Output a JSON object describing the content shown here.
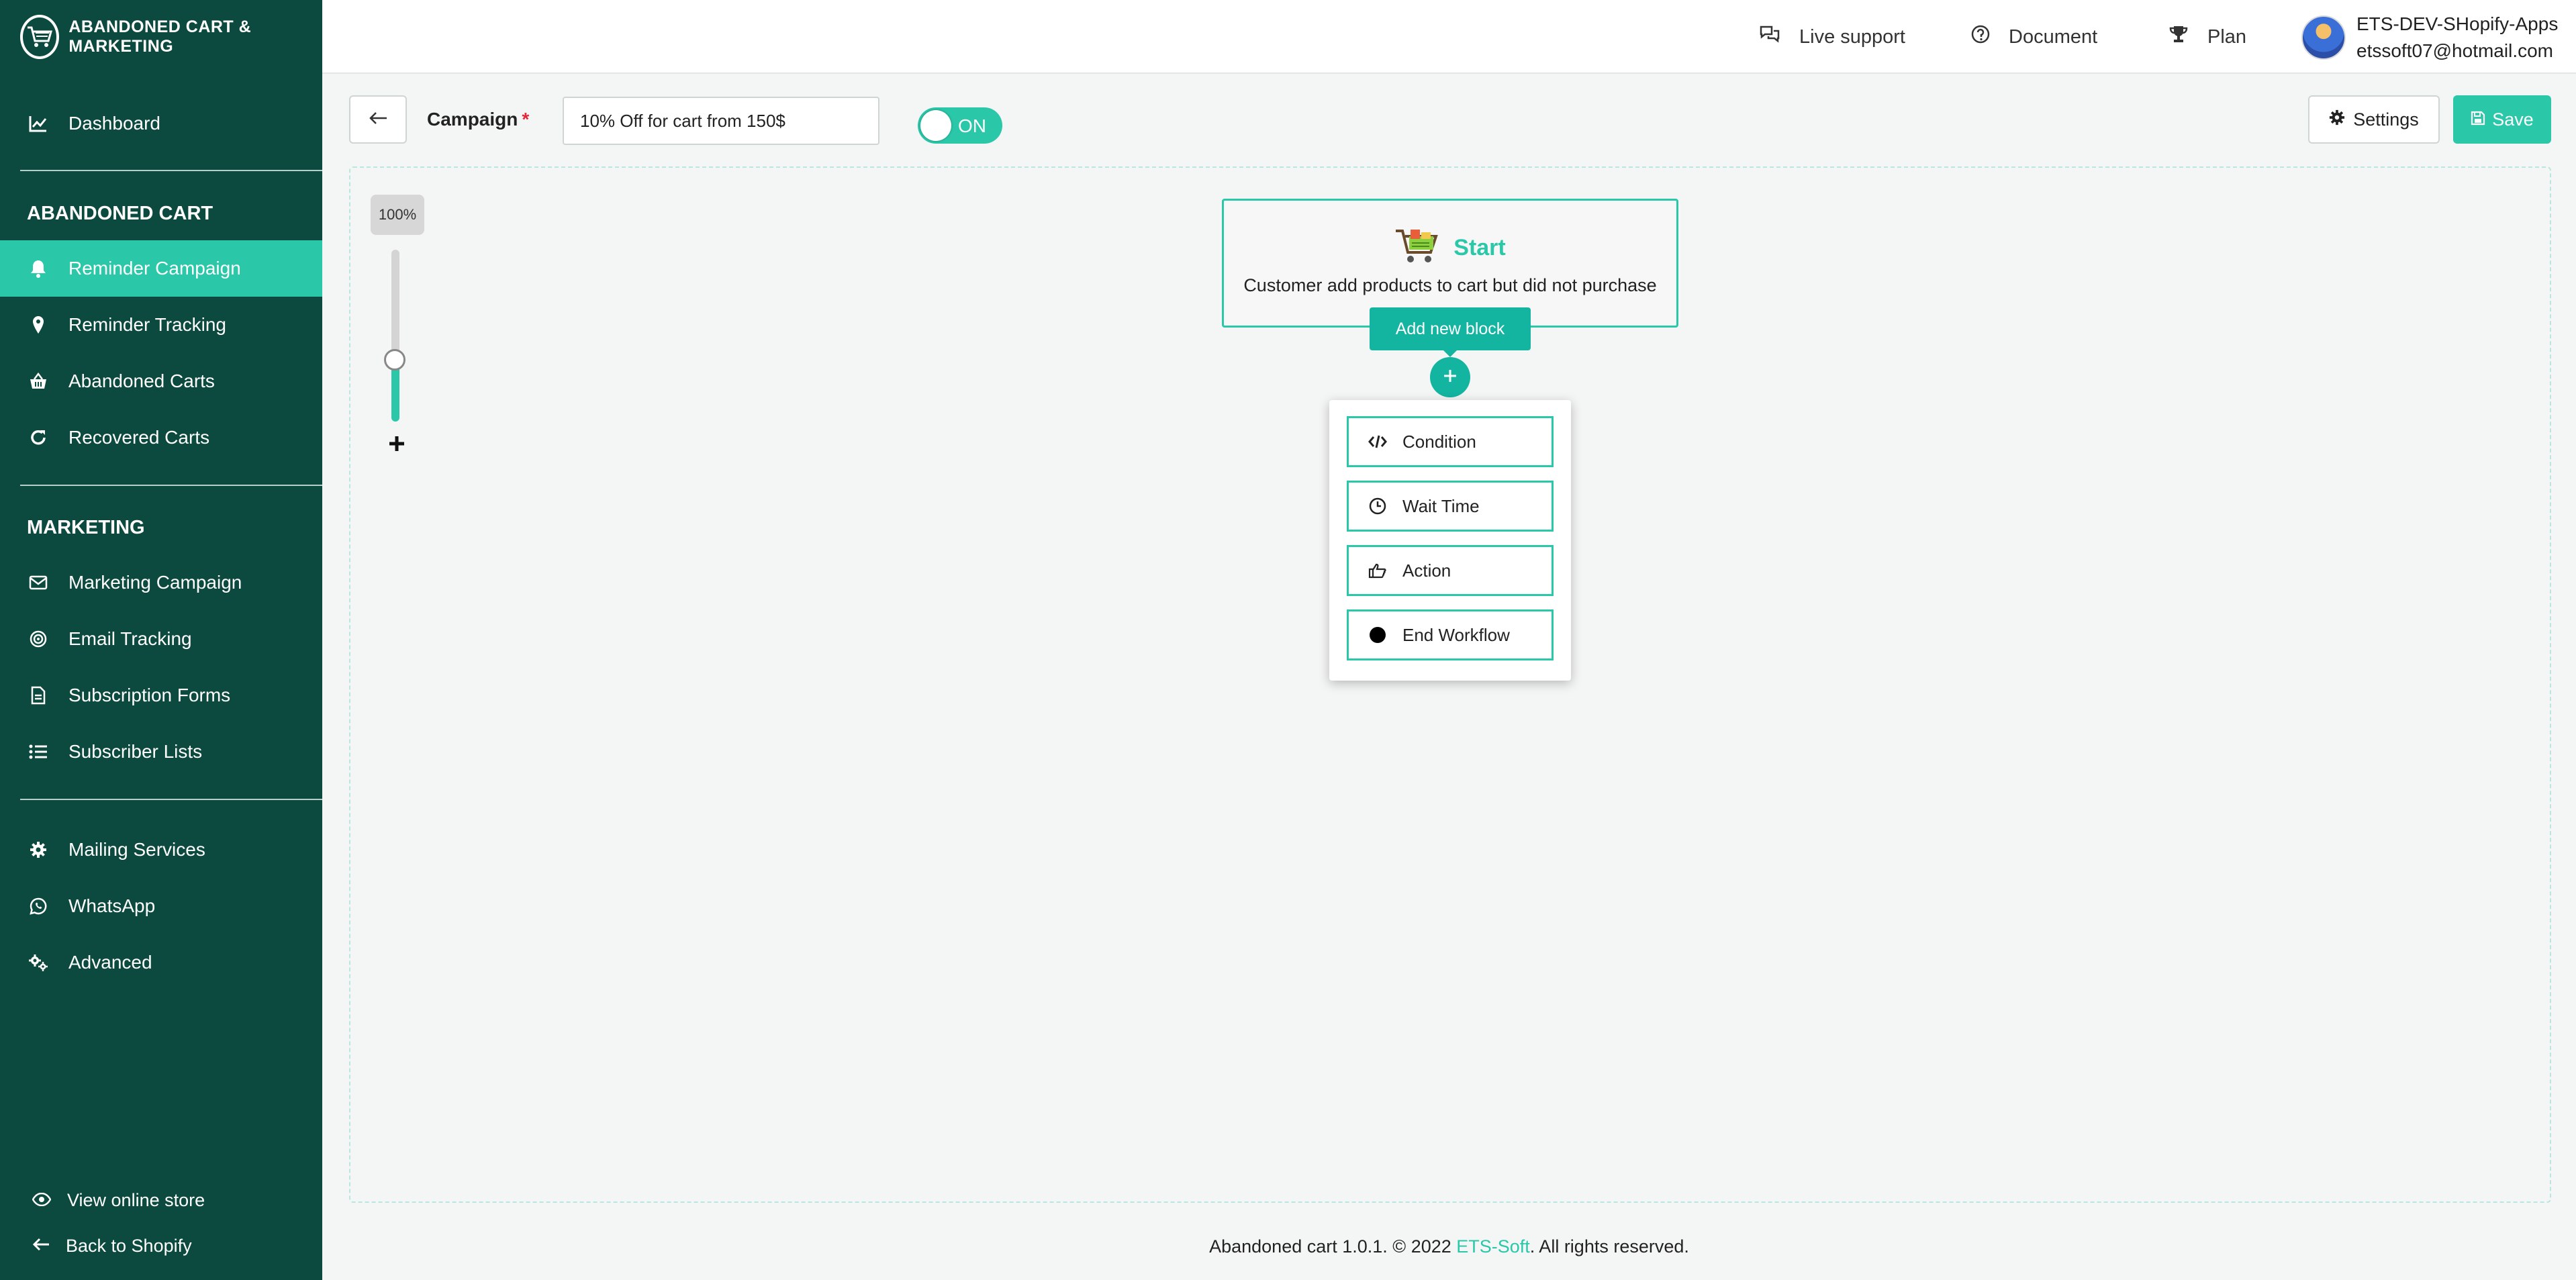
{
  "app": {
    "title": "ABANDONED CART & MARKETING"
  },
  "sidebar": {
    "dashboard": "Dashboard",
    "abandoned_heading": "ABANDONED CART",
    "abandoned_items": [
      {
        "label": "Reminder Campaign",
        "icon": "bell-icon",
        "active": true
      },
      {
        "label": "Reminder Tracking",
        "icon": "map-pin-icon",
        "active": false
      },
      {
        "label": "Abandoned Carts",
        "icon": "basket-icon",
        "active": false
      },
      {
        "label": "Recovered Carts",
        "icon": "refresh-icon",
        "active": false
      }
    ],
    "marketing_heading": "MARKETING",
    "marketing_items": [
      {
        "label": "Marketing Campaign",
        "icon": "envelope-icon"
      },
      {
        "label": "Email Tracking",
        "icon": "target-icon"
      },
      {
        "label": "Subscription Forms",
        "icon": "document-icon"
      },
      {
        "label": "Subscriber Lists",
        "icon": "list-icon"
      }
    ],
    "settings_items": [
      {
        "label": "Mailing Services",
        "icon": "gear-icon"
      },
      {
        "label": "WhatsApp",
        "icon": "whatsapp-icon"
      },
      {
        "label": "Advanced",
        "icon": "gears-icon"
      }
    ],
    "view_store": "View online store",
    "back_shopify": "Back to Shopify"
  },
  "topbar": {
    "live_support": "Live support",
    "document": "Document",
    "plan": "Plan",
    "shop_name": "ETS-DEV-SHopify-Apps",
    "shop_email": "etssoft07@hotmail.com"
  },
  "campaign": {
    "label": "Campaign",
    "required_mark": "*",
    "name_value": "10% Off for cart from 150$",
    "toggle_text": "ON",
    "enabled": true,
    "settings_label": "Settings",
    "save_label": "Save"
  },
  "canvas": {
    "zoom_label": "100%",
    "zoom_level": 0.36,
    "start_title": "Start",
    "start_desc": "Customer add products to cart but did not purchase",
    "add_block_label": "Add new block",
    "menu": [
      {
        "label": "Condition",
        "icon": "code-icon"
      },
      {
        "label": "Wait Time",
        "icon": "clock-icon"
      },
      {
        "label": "Action",
        "icon": "hand-pointer-icon"
      },
      {
        "label": "End Workflow",
        "icon": "filled-circle-icon"
      }
    ]
  },
  "footer": {
    "prefix": "Abandoned cart 1.0.1. © 2022 ",
    "link": "ETS-Soft",
    "suffix": ". All rights reserved."
  },
  "colors": {
    "sidebar_bg": "#0c4a3f",
    "accent": "#2ac7a9",
    "button_teal": "#13b5a0"
  }
}
